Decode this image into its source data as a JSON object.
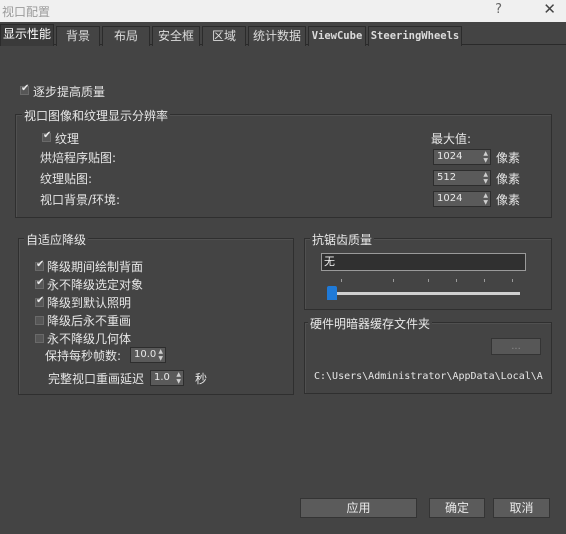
{
  "window": {
    "title": "视口配置",
    "help": "?",
    "close": "✕"
  },
  "tabs": [
    {
      "label": "显示性能"
    },
    {
      "label": "背景"
    },
    {
      "label": "布局"
    },
    {
      "label": "安全框"
    },
    {
      "label": "区域"
    },
    {
      "label": "统计数据"
    },
    {
      "label": "ViewCube"
    },
    {
      "label": "SteeringWheels"
    }
  ],
  "progressive": {
    "label": "逐步提高质量",
    "checked": true
  },
  "resolution_group": {
    "title": "视口图像和纹理显示分辨率",
    "texture": {
      "label": "纹理",
      "checked": true
    },
    "max_label": "最大值:",
    "rows": [
      {
        "label": "烘焙程序贴图:",
        "value": "1024",
        "unit": "像素"
      },
      {
        "label": "纹理贴图:",
        "value": "512",
        "unit": "像素"
      },
      {
        "label": "视口背景/环境:",
        "value": "1024",
        "unit": "像素"
      }
    ]
  },
  "adaptive_group": {
    "title": "自适应降级",
    "options": [
      {
        "label": "降级期间绘制背面",
        "checked": true
      },
      {
        "label": "永不降级选定对象",
        "checked": true
      },
      {
        "label": "降级到默认照明",
        "checked": true
      },
      {
        "label": "降级后永不重画",
        "checked": false
      },
      {
        "label": "永不降级几何体",
        "checked": false
      }
    ],
    "fps_label": "保持每秒帧数:",
    "fps_value": "10.0",
    "delay_label": "完整视口重画延迟",
    "delay_value": "1.0",
    "delay_unit": "秒"
  },
  "antialias_group": {
    "title": "抗锯齿质量",
    "value": "无",
    "slider_fraction": 0.0
  },
  "shader_cache_group": {
    "title": "硬件明暗器缓存文件夹",
    "browse_label": "...",
    "path": "C:\\Users\\Administrator\\AppData\\Local\\A"
  },
  "footer": {
    "apply": "应用",
    "ok": "确定",
    "cancel": "取消"
  },
  "colors": {
    "background": "#444444",
    "slider_thumb": "#1f7ad8"
  }
}
